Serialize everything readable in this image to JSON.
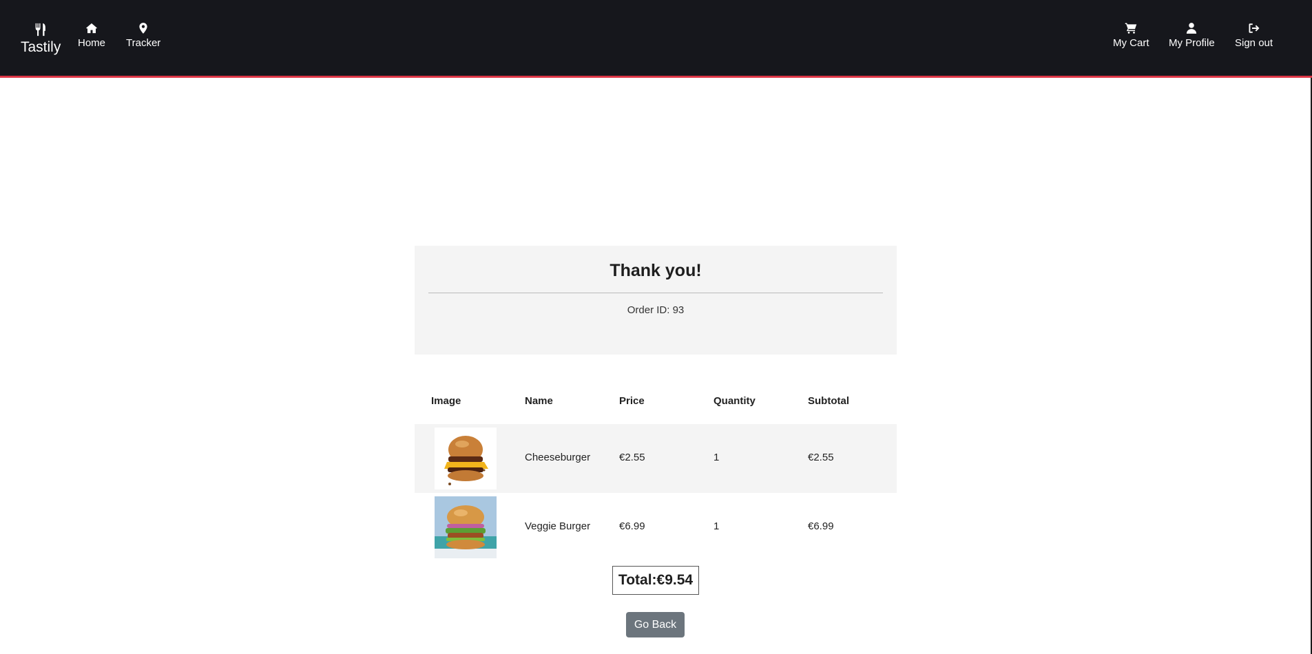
{
  "navbar": {
    "brand": "Tastily",
    "brand_icon": "utensils-icon",
    "left_items": [
      {
        "label": "Home",
        "icon": "home-icon"
      },
      {
        "label": "Tracker",
        "icon": "map-pin-icon"
      }
    ],
    "right_items": [
      {
        "label": "My Cart",
        "icon": "cart-icon"
      },
      {
        "label": "My Profile",
        "icon": "user-icon"
      },
      {
        "label": "Sign out",
        "icon": "sign-out-icon"
      }
    ],
    "accent_color": "#dc3545",
    "background_color": "#16171c"
  },
  "confirmation": {
    "title": "Thank you!",
    "order_id_text": "Order ID: 93"
  },
  "table": {
    "headers": [
      "Image",
      "Name",
      "Price",
      "Quantity",
      "Subtotal"
    ],
    "rows": [
      {
        "image": "cheeseburger-image",
        "name": "Cheeseburger",
        "price": "€2.55",
        "quantity": "1",
        "subtotal": "€2.55"
      },
      {
        "image": "veggie-burger-image",
        "name": "Veggie Burger",
        "price": "€6.99",
        "quantity": "1",
        "subtotal": "€6.99"
      }
    ]
  },
  "total": {
    "text": "Total:€9.54"
  },
  "actions": {
    "go_back_label": "Go Back",
    "go_back_color": "#6c757d"
  }
}
